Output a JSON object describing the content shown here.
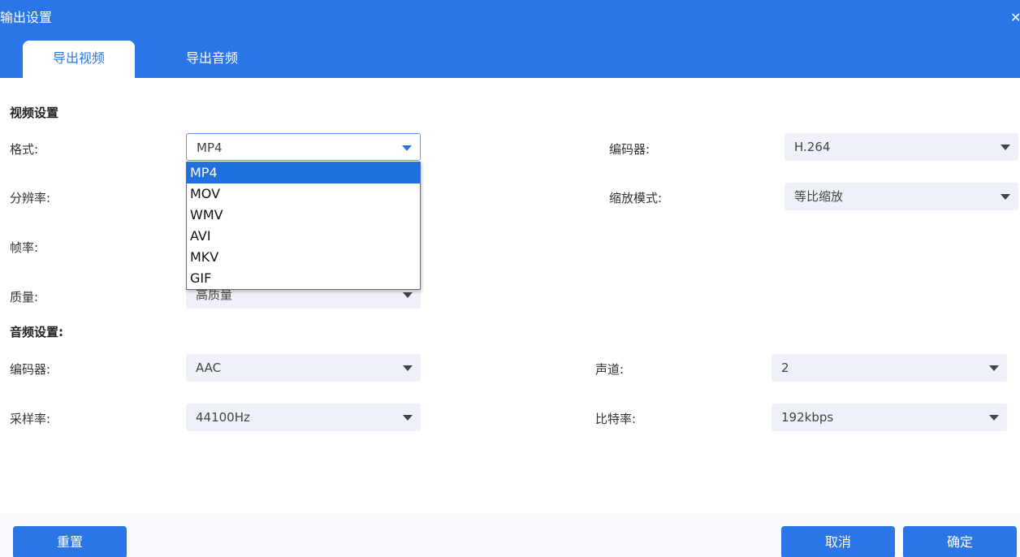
{
  "window": {
    "title": "输出设置",
    "close_icon": "close-icon"
  },
  "tabs": [
    {
      "label": "导出视频",
      "active": true
    },
    {
      "label": "导出音频",
      "active": false
    }
  ],
  "video": {
    "section_title": "视频设置",
    "format": {
      "label": "格式:",
      "value": "MP4"
    },
    "encoder": {
      "label": "编码器:",
      "value": "H.264"
    },
    "resolution": {
      "label": "分辨率:"
    },
    "scale_mode": {
      "label": "缩放模式:",
      "value": "等比缩放"
    },
    "frame_rate": {
      "label": "帧率:"
    },
    "quality": {
      "label": "质量:",
      "value": "高质量"
    }
  },
  "format_dropdown": {
    "options": [
      "MP4",
      "MOV",
      "WMV",
      "AVI",
      "MKV",
      "GIF"
    ],
    "selected": "MP4"
  },
  "audio": {
    "section_title": "音频设置:",
    "encoder": {
      "label": "编码器:",
      "value": "AAC"
    },
    "channel": {
      "label": "声道:",
      "value": "2"
    },
    "sample_rate": {
      "label": "采样率:",
      "value": "44100Hz"
    },
    "bitrate": {
      "label": "比特率:",
      "value": "192kbps"
    }
  },
  "buttons": {
    "reset": "重置",
    "cancel": "取消",
    "confirm": "确定"
  },
  "colors": {
    "accent": "#2a76e6",
    "selected_option": "#1f6fde",
    "field_bg": "#eef2f8"
  }
}
